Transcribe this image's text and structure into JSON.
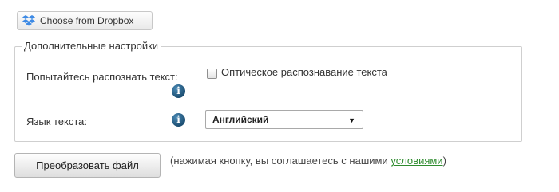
{
  "dropbox": {
    "label": "Choose from Dropbox",
    "icon": "dropbox-icon",
    "icon_color": "#3d8ae5"
  },
  "settings": {
    "legend": "Дополнительные настройки",
    "ocr_label": "Попытайтесь распознать текст:",
    "ocr_checkbox_label": "Оптическое распознавание текста",
    "ocr_checked": false,
    "language_label": "Язык текста:",
    "language_selected": "Английский",
    "info_icon_glyph": "i"
  },
  "action": {
    "convert_label": "Преобразовать файл",
    "consent_prefix": "(нажимая кнопку, вы соглашаетесь с нашими",
    "consent_link": "условиями",
    "consent_suffix": ")",
    "link_color": "#2e8b2e"
  }
}
